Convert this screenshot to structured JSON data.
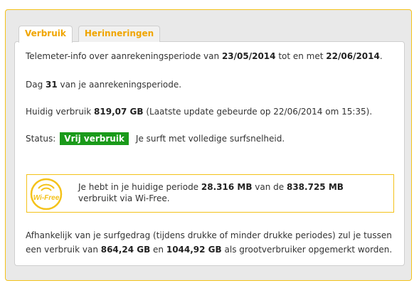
{
  "tabs": [
    {
      "label": "Verbruik",
      "active": true
    },
    {
      "label": "Herinneringen",
      "active": false
    }
  ],
  "telemeter": {
    "prefix": "Telemeter-info over aanrekeningsperiode van ",
    "start_date": "23/05/2014",
    "middle": " tot en met ",
    "end_date": "22/06/2014",
    "suffix": "."
  },
  "day": {
    "prefix": "Dag ",
    "number": "31",
    "suffix": " van je aanrekeningsperiode."
  },
  "usage": {
    "prefix": "Huidig verbruik ",
    "amount": "819,07 GB",
    "suffix": " (Laatste update gebeurde op 22/06/2014 om 15:35)."
  },
  "status": {
    "label": "Status:",
    "badge": "Vrij verbruik",
    "badge_color": "#1a9a1a",
    "message": "Je surft met volledige surfsnelheid."
  },
  "wifree": {
    "logo_text": "Wi-Free",
    "logo_color": "#f4c21a",
    "prefix": "Je hebt in je huidige periode ",
    "used": "28.316 MB",
    "middle": " van de ",
    "total": "838.725 MB",
    "suffix": " verbruikt via Wi-Free."
  },
  "footer": {
    "prefix": "Afhankelijk van je surfgedrag (tijdens drukke of minder drukke periodes) zul je tussen een verbruik van ",
    "low": "864,24 GB",
    "middle": " en ",
    "high": "1044,92 GB",
    "suffix": " als grootverbruiker opgemerkt worden."
  },
  "colors": {
    "accent": "#f4c21a",
    "tab_text": "#f0a500",
    "background": "#e9e9e9"
  }
}
